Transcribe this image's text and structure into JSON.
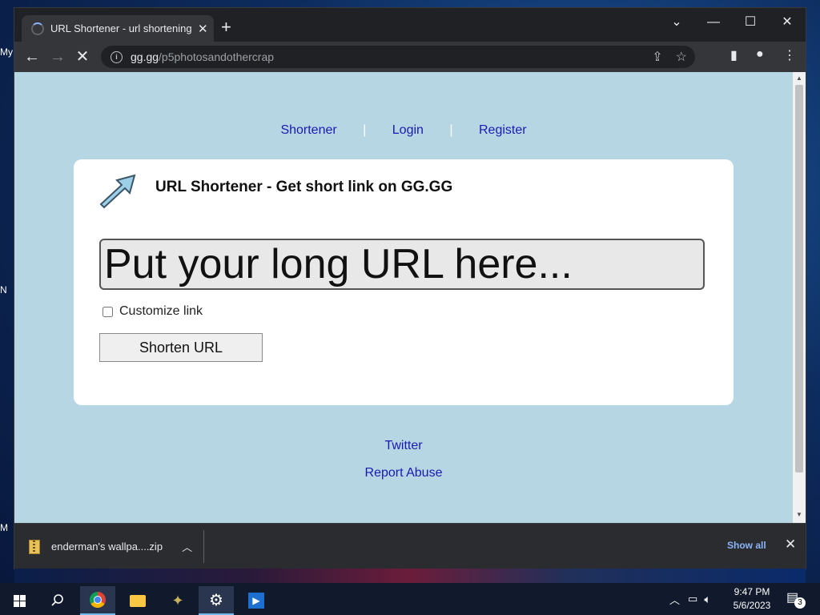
{
  "desktop": {
    "fragments": [
      "My",
      "N",
      "M"
    ]
  },
  "browser": {
    "tab": {
      "title": "URL Shortener - url shortening se",
      "close": "✕"
    },
    "new_tab": "+",
    "window": {
      "dropdown": "⌄",
      "minimize": "—",
      "maximize": "☐",
      "close": "✕"
    },
    "nav": {
      "back": "←",
      "forward": "→",
      "stop": "✕"
    },
    "address": {
      "host": "gg.gg",
      "path": "/p5photosandothercrap"
    }
  },
  "page": {
    "nav": {
      "shortener": "Shortener",
      "login": "Login",
      "register": "Register",
      "separator": "|"
    },
    "card": {
      "title": "URL Shortener - Get short link on GG.GG",
      "url_placeholder": "Put your long URL here...",
      "customize_label": "Customize link",
      "customize_checked": false,
      "submit_label": "Shorten URL"
    },
    "footer": {
      "twitter": "Twitter",
      "report_abuse": "Report Abuse"
    }
  },
  "downloads": {
    "item_name": "enderman's wallpa....zip",
    "show_all": "Show all",
    "close": "✕"
  },
  "taskbar": {
    "time": "9:47 PM",
    "date": "5/6/2023",
    "notification_count": "3"
  },
  "colors": {
    "page_background": "#b7d6e4",
    "link": "#1a1ab0",
    "chrome_dark": "#202124",
    "show_all": "#8ab4f8"
  }
}
